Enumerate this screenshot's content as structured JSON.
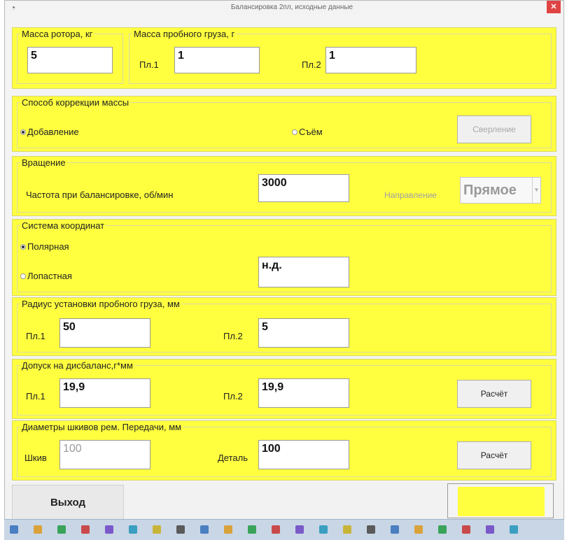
{
  "window": {
    "title": "Балансировка 2пл, исходные данные",
    "close": "✕",
    "icon": "◔"
  },
  "rotor_mass": {
    "legend": "Масса ротора, кг",
    "value": "5"
  },
  "trial_mass": {
    "legend": "Масса пробного груза, г",
    "p1_label": "Пл.1",
    "p1_value": "1",
    "p2_label": "Пл.2",
    "p2_value": "1"
  },
  "correction": {
    "legend": "Способ коррекции массы",
    "option_add": "Добавление",
    "option_remove": "Съём",
    "selected": "Добавление",
    "drill_button": "Сверление"
  },
  "rotation": {
    "legend": "Вращение",
    "freq_label": "Частота при балансировке, об/мин",
    "freq_value": "3000",
    "direction_label": "Направление",
    "direction_value": "Прямое"
  },
  "coordinates": {
    "legend": "Система координат",
    "option_polar": "Полярная",
    "option_blade": "Лопастная",
    "selected": "Полярная",
    "blades_value": "н.д."
  },
  "trial_radius": {
    "legend": "Радиус установки пробного груза, мм",
    "p1_label": "Пл.1",
    "p1_value": "50",
    "p2_label": "Пл.2",
    "p2_value": "5"
  },
  "tolerance": {
    "legend": "Допуск на дисбаланс,г*мм",
    "p1_label": "Пл.1",
    "p1_value": "19,9",
    "p2_label": "Пл.2",
    "p2_value": "19,9",
    "calc_button": "Расчёт"
  },
  "pulleys": {
    "legend": "Диаметры шкивов рем. Передачи, мм",
    "pulley_label": "Шкив",
    "pulley_value": "100",
    "part_label": "Деталь",
    "part_value": "100",
    "calc_button": "Расчёт"
  },
  "footer": {
    "exit_button": "Выход"
  },
  "colors": {
    "panel": "#ffff40",
    "close": "#e04343"
  },
  "taskbar_icons": [
    "file-icon",
    "app-icon",
    "folder-icon",
    "globe-icon",
    "app-icon",
    "doc-icon",
    "app-icon",
    "tool-icon",
    "app-icon",
    "app-icon",
    "app-icon",
    "app-icon",
    "app-icon",
    "app-icon",
    "app-icon",
    "app-icon",
    "app-icon",
    "app-icon",
    "app-icon",
    "app-icon",
    "app-icon",
    "app-icon"
  ]
}
